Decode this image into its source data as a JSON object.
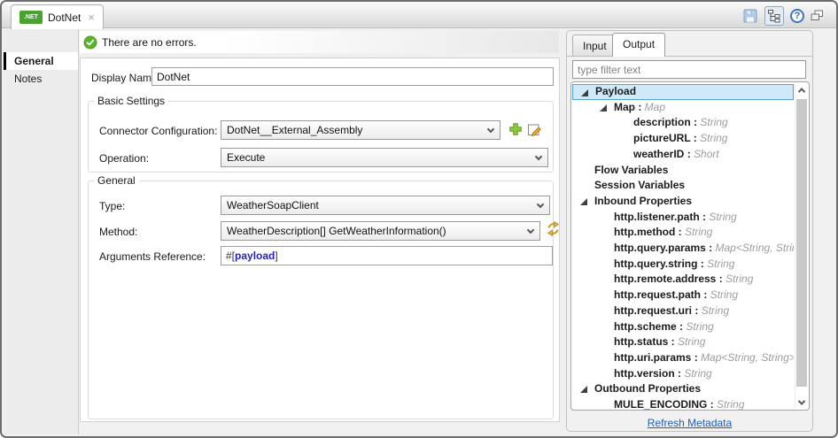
{
  "window": {
    "tab": {
      "badge": ".NET",
      "title": "DotNet",
      "close_glyph": "×"
    },
    "toolbar": {
      "icons": [
        "save",
        "tree-view",
        "help",
        "restore"
      ],
      "help_glyph": "?"
    }
  },
  "sidebar": {
    "items": [
      {
        "label": "General",
        "selected": true
      },
      {
        "label": "Notes",
        "selected": false
      }
    ]
  },
  "editor": {
    "status": "There are no errors.",
    "display_name": {
      "label": "Display Name:",
      "value": "DotNet"
    },
    "basic_settings": {
      "legend": "Basic Settings",
      "connector_configuration": {
        "label": "Connector Configuration:",
        "value": "DotNet__External_Assembly"
      },
      "operation": {
        "label": "Operation:",
        "value": "Execute"
      }
    },
    "general": {
      "legend": "General",
      "type": {
        "label": "Type:",
        "value": "WeatherSoapClient"
      },
      "method": {
        "label": "Method:",
        "value": "WeatherDescription[] GetWeatherInformation()"
      },
      "arguments_reference": {
        "label": "Arguments Reference:",
        "prefix": "#[",
        "keyword": "payload",
        "suffix": "]"
      }
    }
  },
  "metadata_panel": {
    "tabs": [
      {
        "label": "Input",
        "selected": false
      },
      {
        "label": "Output",
        "selected": true
      }
    ],
    "filter_placeholder": "type filter text",
    "tree": [
      {
        "label": "Payload",
        "level": 0,
        "expanded": true,
        "selected": true
      },
      {
        "label": "Map",
        "type": "Map",
        "level": 1,
        "expanded": true
      },
      {
        "label": "description",
        "type": "String",
        "level": 2
      },
      {
        "label": "pictureURL",
        "type": "String",
        "level": 2
      },
      {
        "label": "weatherID",
        "type": "Short",
        "level": 2
      },
      {
        "label": "Flow Variables",
        "level": 0
      },
      {
        "label": "Session Variables",
        "level": 0
      },
      {
        "label": "Inbound Properties",
        "level": 0,
        "expanded": true
      },
      {
        "label": "http.listener.path",
        "type": "String",
        "level": 1
      },
      {
        "label": "http.method",
        "type": "String",
        "level": 1
      },
      {
        "label": "http.query.params",
        "type": "Map<String, String>",
        "level": 1
      },
      {
        "label": "http.query.string",
        "type": "String",
        "level": 1
      },
      {
        "label": "http.remote.address",
        "type": "String",
        "level": 1
      },
      {
        "label": "http.request.path",
        "type": "String",
        "level": 1
      },
      {
        "label": "http.request.uri",
        "type": "String",
        "level": 1
      },
      {
        "label": "http.scheme",
        "type": "String",
        "level": 1
      },
      {
        "label": "http.status",
        "type": "String",
        "level": 1
      },
      {
        "label": "http.uri.params",
        "type": "Map<String, String>",
        "level": 1
      },
      {
        "label": "http.version",
        "type": "String",
        "level": 1
      },
      {
        "label": "Outbound Properties",
        "level": 0,
        "expanded": true
      },
      {
        "label": "MULE_ENCODING",
        "type": "String",
        "level": 1
      }
    ],
    "refresh_link": "Refresh Metadata"
  },
  "colors": {
    "selection_bg": "#cfe9f8",
    "selection_border": "#55a2d3",
    "link_blue": "#1b5cc4",
    "payload_keyword_blue": "#2222cc",
    "badge_green": "#4aa32e",
    "status_check_green": "#5bb42d",
    "refresh_icon_gold": "#cc9a1c",
    "plus_icon_green": "#8dc63f"
  }
}
